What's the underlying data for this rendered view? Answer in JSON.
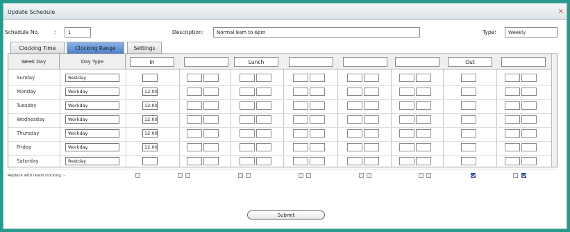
{
  "window": {
    "title": "Update Schedule",
    "close": "×"
  },
  "form": {
    "schedule_no_label": "Schedule No.",
    "schedule_no_sep": ":",
    "schedule_no_value": "1",
    "description_label": "Description:",
    "description_value": "Normal 9am to 6pm",
    "type_label": "Type:",
    "type_value": "Weekly"
  },
  "tabs": [
    {
      "label": "Clocking Time"
    },
    {
      "label": "Clocking Range"
    },
    {
      "label": "Settings"
    }
  ],
  "columns": {
    "week_day": "Week Day",
    "day_type": "Day Type",
    "in": "In",
    "lunch": "Lunch",
    "out": "Out"
  },
  "rows": [
    {
      "day": "Sunday",
      "type": "Restday",
      "in": ""
    },
    {
      "day": "Monday",
      "type": "Workday",
      "in": "12:00"
    },
    {
      "day": "Tuesday",
      "type": "Workday",
      "in": "12:00"
    },
    {
      "day": "Wednesday",
      "type": "Workday",
      "in": "12:00"
    },
    {
      "day": "Thursday",
      "type": "Workday",
      "in": "12:00"
    },
    {
      "day": "Friday",
      "type": "Workday",
      "in": "12:00"
    },
    {
      "day": "Saturday",
      "type": "Restday",
      "in": ""
    }
  ],
  "replace_label": "Replace with latest clocking :-",
  "submit_label": "Submit",
  "colors": {
    "frame": "#279a8d",
    "active_tab": "#4f7fc6",
    "check": "#4f66b0"
  }
}
